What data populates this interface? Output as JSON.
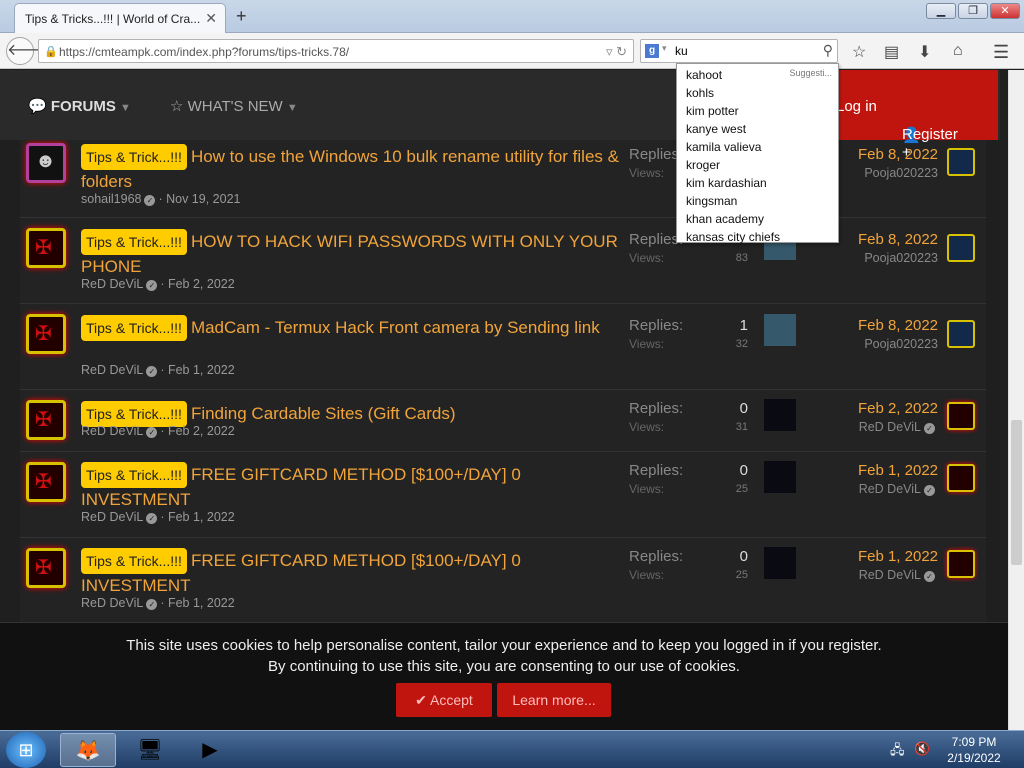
{
  "browser": {
    "tab_title": "Tips & Tricks...!!! | World of Cra...",
    "url": "https://cmteampk.com/index.php?forums/tips-tricks.78/",
    "search_value": "ku",
    "suggest_header": "Suggesti...",
    "suggestions": [
      "kahoot",
      "kohls",
      "kim potter",
      "kanye west",
      "kamila valieva",
      "kroger",
      "kim kardashian",
      "kingsman",
      "khan academy",
      "kansas city chiefs"
    ]
  },
  "site_nav": {
    "forums": "FORUMS",
    "whats_new": "WHAT'S NEW",
    "login": "Log in",
    "register": "Register"
  },
  "threads": [
    {
      "badge": "Tips & Trick...!!!",
      "title": "How to use the Windows 10 bulk rename utility for files & folders",
      "author": "sohail1968",
      "date": "Nov 19, 2021",
      "replies_label": "Replies:",
      "views_label": "Views:",
      "replies": "",
      "views": "",
      "last_date": "Feb 8, 2022",
      "last_user": "Pooja020223"
    },
    {
      "badge": "Tips & Trick...!!!",
      "title": "HOW TO HACK WIFI PASSWORDS WITH ONLY YOUR PHONE",
      "author": "ReD DeViL",
      "date": "Feb 2, 2022",
      "replies_label": "Replies:",
      "views_label": "Views:",
      "replies": "",
      "views": "83",
      "last_date": "Feb 8, 2022",
      "last_user": "Pooja020223"
    },
    {
      "badge": "Tips & Trick...!!!",
      "title": "MadCam - Termux Hack Front camera by Sending link",
      "author": "ReD DeViL",
      "date": "Feb 1, 2022",
      "replies_label": "Replies:",
      "views_label": "Views:",
      "replies": "1",
      "views": "32",
      "last_date": "Feb 8, 2022",
      "last_user": "Pooja020223"
    },
    {
      "badge": "Tips & Trick...!!!",
      "title": "Finding Cardable Sites (Gift Cards)",
      "author": "ReD DeViL",
      "date": "Feb 2, 2022",
      "replies_label": "Replies:",
      "views_label": "Views:",
      "replies": "0",
      "views": "31",
      "last_date": "Feb 2, 2022",
      "last_user": "ReD DeViL"
    },
    {
      "badge": "Tips & Trick...!!!",
      "title": "FREE GIFTCARD METHOD [$100+/DAY] 0 INVESTMENT",
      "author": "ReD DeViL",
      "date": "Feb 1, 2022",
      "replies_label": "Replies:",
      "views_label": "Views:",
      "replies": "0",
      "views": "25",
      "last_date": "Feb 1, 2022",
      "last_user": "ReD DeViL"
    },
    {
      "badge": "Tips & Trick...!!!",
      "title": "FREE GIFTCARD METHOD [$100+/DAY] 0 INVESTMENT",
      "author": "ReD DeViL",
      "date": "Feb 1, 2022",
      "replies_label": "Replies:",
      "views_label": "Views:",
      "replies": "0",
      "views": "25",
      "last_date": "Feb 1, 2022",
      "last_user": "ReD DeViL"
    }
  ],
  "cookie": {
    "line1": "This site uses cookies to help personalise content, tailor your experience and to keep you logged in if you register.",
    "line2": "By continuing to use this site, you are consenting to our use of cookies.",
    "accept": "Accept",
    "learn_more": "Learn more..."
  },
  "taskbar": {
    "time": "7:09 PM",
    "date": "2/19/2022"
  },
  "colors": {
    "accent": "#c0150f",
    "title": "#f0a43b",
    "badge": "#ffcc00"
  }
}
